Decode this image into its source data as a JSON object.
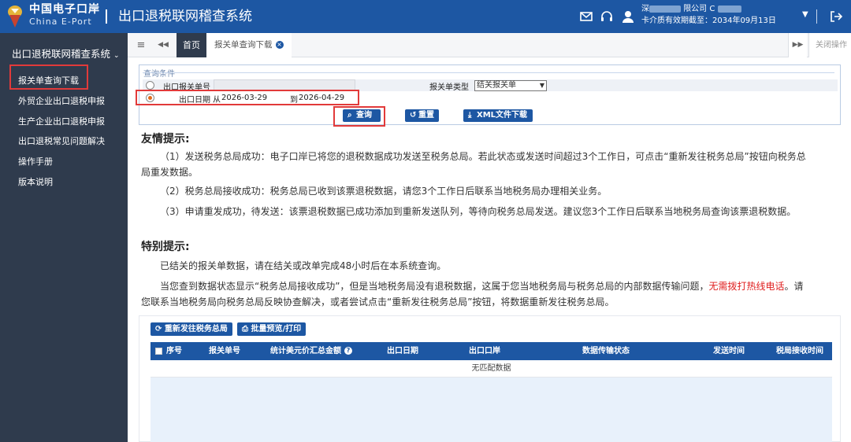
{
  "header": {
    "brand_cn": "中国电子口岸",
    "brand_en": "China E-Port",
    "system_title": "出口退税联网稽查系统",
    "user_company_visible": "限公司 C",
    "user_company_prefix": "深",
    "user_card_expiry": "卡介质有效期截至：2034年09月13日",
    "icons": [
      "mail-icon",
      "headset-icon",
      "user-icon",
      "chevron-down-icon",
      "logout-icon"
    ]
  },
  "sidebar": {
    "title": "出口退税联网稽查系统",
    "items": [
      {
        "label": "报关单查询下载",
        "selected": true
      },
      {
        "label": "外贸企业出口退税申报"
      },
      {
        "label": "生产企业出口退税申报"
      },
      {
        "label": "出口退税常见问题解决"
      },
      {
        "label": "操作手册"
      },
      {
        "label": "版本说明"
      }
    ]
  },
  "tabs": {
    "menu_glyph": "≡",
    "prev_glyph": "◀◀",
    "next_glyph": "▶▶",
    "home": "首页",
    "current": "报关单查询下载",
    "close_ops": "关闭操作"
  },
  "query": {
    "legend": "查询条件",
    "label_decl_no": "出口报关单号",
    "label_decl_type": "报关单类型",
    "decl_type_value": "结关报关单",
    "label_export_date": "出口日期",
    "from_label": "从",
    "date_from": "2026-03-29",
    "to_label": "到",
    "date_to": "2026-04-29",
    "btn_query": "查询",
    "btn_reset": "重置",
    "btn_xml": "XML文件下载"
  },
  "notice": {
    "heading1": "友情提示:",
    "p1": "（1）发送税务总局成功：电子口岸已将您的退税数据成功发送至税务总局。若此状态或发送时间超过3个工作日，可点击“重新发往税务总局”按钮向税务总局重发数据。",
    "p2": "（2）税务总局接收成功：税务总局已收到该票退税数据，请您3个工作日后联系当地税务局办理相关业务。",
    "p3": "（3）申请重发成功，待发送：该票退税数据已成功添加到重新发送队列，等待向税务总局发送。建议您3个工作日后联系当地税务局查询该票退税数据。",
    "heading2": "特别提示:",
    "s1": "已结关的报关单数据，请在结关或改单完成48小时后在本系统查询。",
    "s2_a": "当您查到数据状态显示“税务总局接收成功”，但是当地税务局没有退税数据，这属于您当地税务局与税务总局的内部数据传输问题，",
    "s2_red": "无需拨打热线电话",
    "s2_b": "。请您联系当地税务局向税务总局反映协查解决，或者尝试点击“重新发往税务总局”按钮，将数据重新发往税务总局。"
  },
  "results": {
    "btn_resend": "重新发往税务总局",
    "btn_print": "批量预览/打印",
    "columns": [
      "序号",
      "报关单号",
      "统计美元价汇总金额",
      "出口日期",
      "出口口岸",
      "数据传输状态",
      "发送时间",
      "税局接收时间"
    ],
    "empty_text": "无匹配数据"
  },
  "colors": {
    "primary": "#1d57a3",
    "sidebar_bg": "#2f3b4d",
    "highlight_red": "#e23a3a",
    "radio_selected": "#e06a1a"
  }
}
